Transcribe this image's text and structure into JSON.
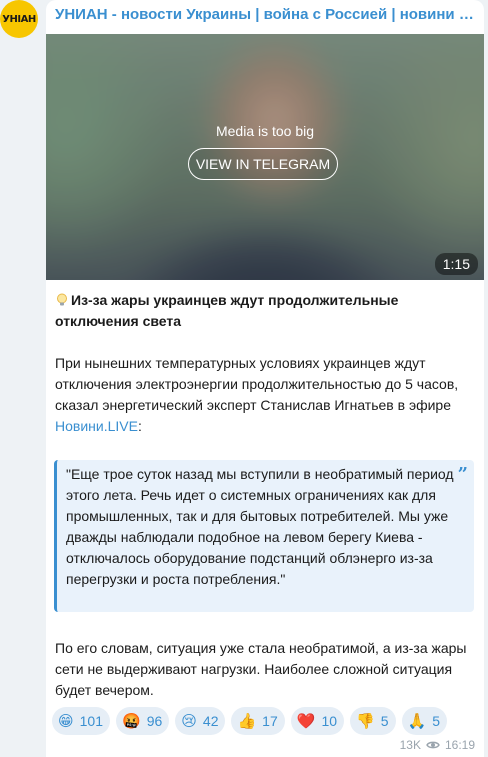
{
  "channel": {
    "title": "УНИАН - новости Украины | война с Россией | новини Украї...",
    "avatar_text": "УНІАН"
  },
  "media": {
    "notice": "Media is too big",
    "button_label": "VIEW IN TELEGRAM",
    "duration": "1:15"
  },
  "post": {
    "headline": "Из-за жары украинцев ждут продолжительные отключения света",
    "para1_text": "При нынешних температурных условиях украинцев ждут отключения электроэнергии продолжительностью до 5 часов, сказал энергетический эксперт Станислав Игнатьев в эфире ",
    "para1_link": "Новини.LIVE",
    "para1_tail": ":",
    "quote": "\"Еще трое суток назад мы вступили в необратимый период этого лета. Речь идет о системных ограничениях как для промышленных, так и для бытовых потребителей. Мы уже дважды наблюдали подобное на левом берегу Киева - отключалось оборудование подстанций облэнерго из-за перегрузки и роста потребления.\"",
    "para2": "По его словам, ситуация уже стала необратимой, а из-за жары сети не выдерживают нагрузки. Наиболее сложной ситуация будет вечером."
  },
  "reactions": [
    {
      "emoji": "😁",
      "count": "101",
      "icon": "grin-emoji-icon"
    },
    {
      "emoji": "🤬",
      "count": "96",
      "icon": "angry-emoji-icon"
    },
    {
      "emoji": "😢",
      "count": "42",
      "icon": "crying-emoji-icon"
    },
    {
      "emoji": "👍",
      "count": "17",
      "icon": "thumbs-up-emoji-icon"
    },
    {
      "emoji": "❤️",
      "count": "10",
      "icon": "heart-emoji-icon"
    },
    {
      "emoji": "👎",
      "count": "5",
      "icon": "thumbs-down-emoji-icon"
    },
    {
      "emoji": "🙏",
      "count": "5",
      "icon": "pray-emoji-icon"
    }
  ],
  "meta": {
    "views": "13K",
    "time": "16:19"
  },
  "colors": {
    "accent": "#3a8fd0",
    "avatar_bg": "#f7c600",
    "quote_bg": "#e9f2fb"
  }
}
